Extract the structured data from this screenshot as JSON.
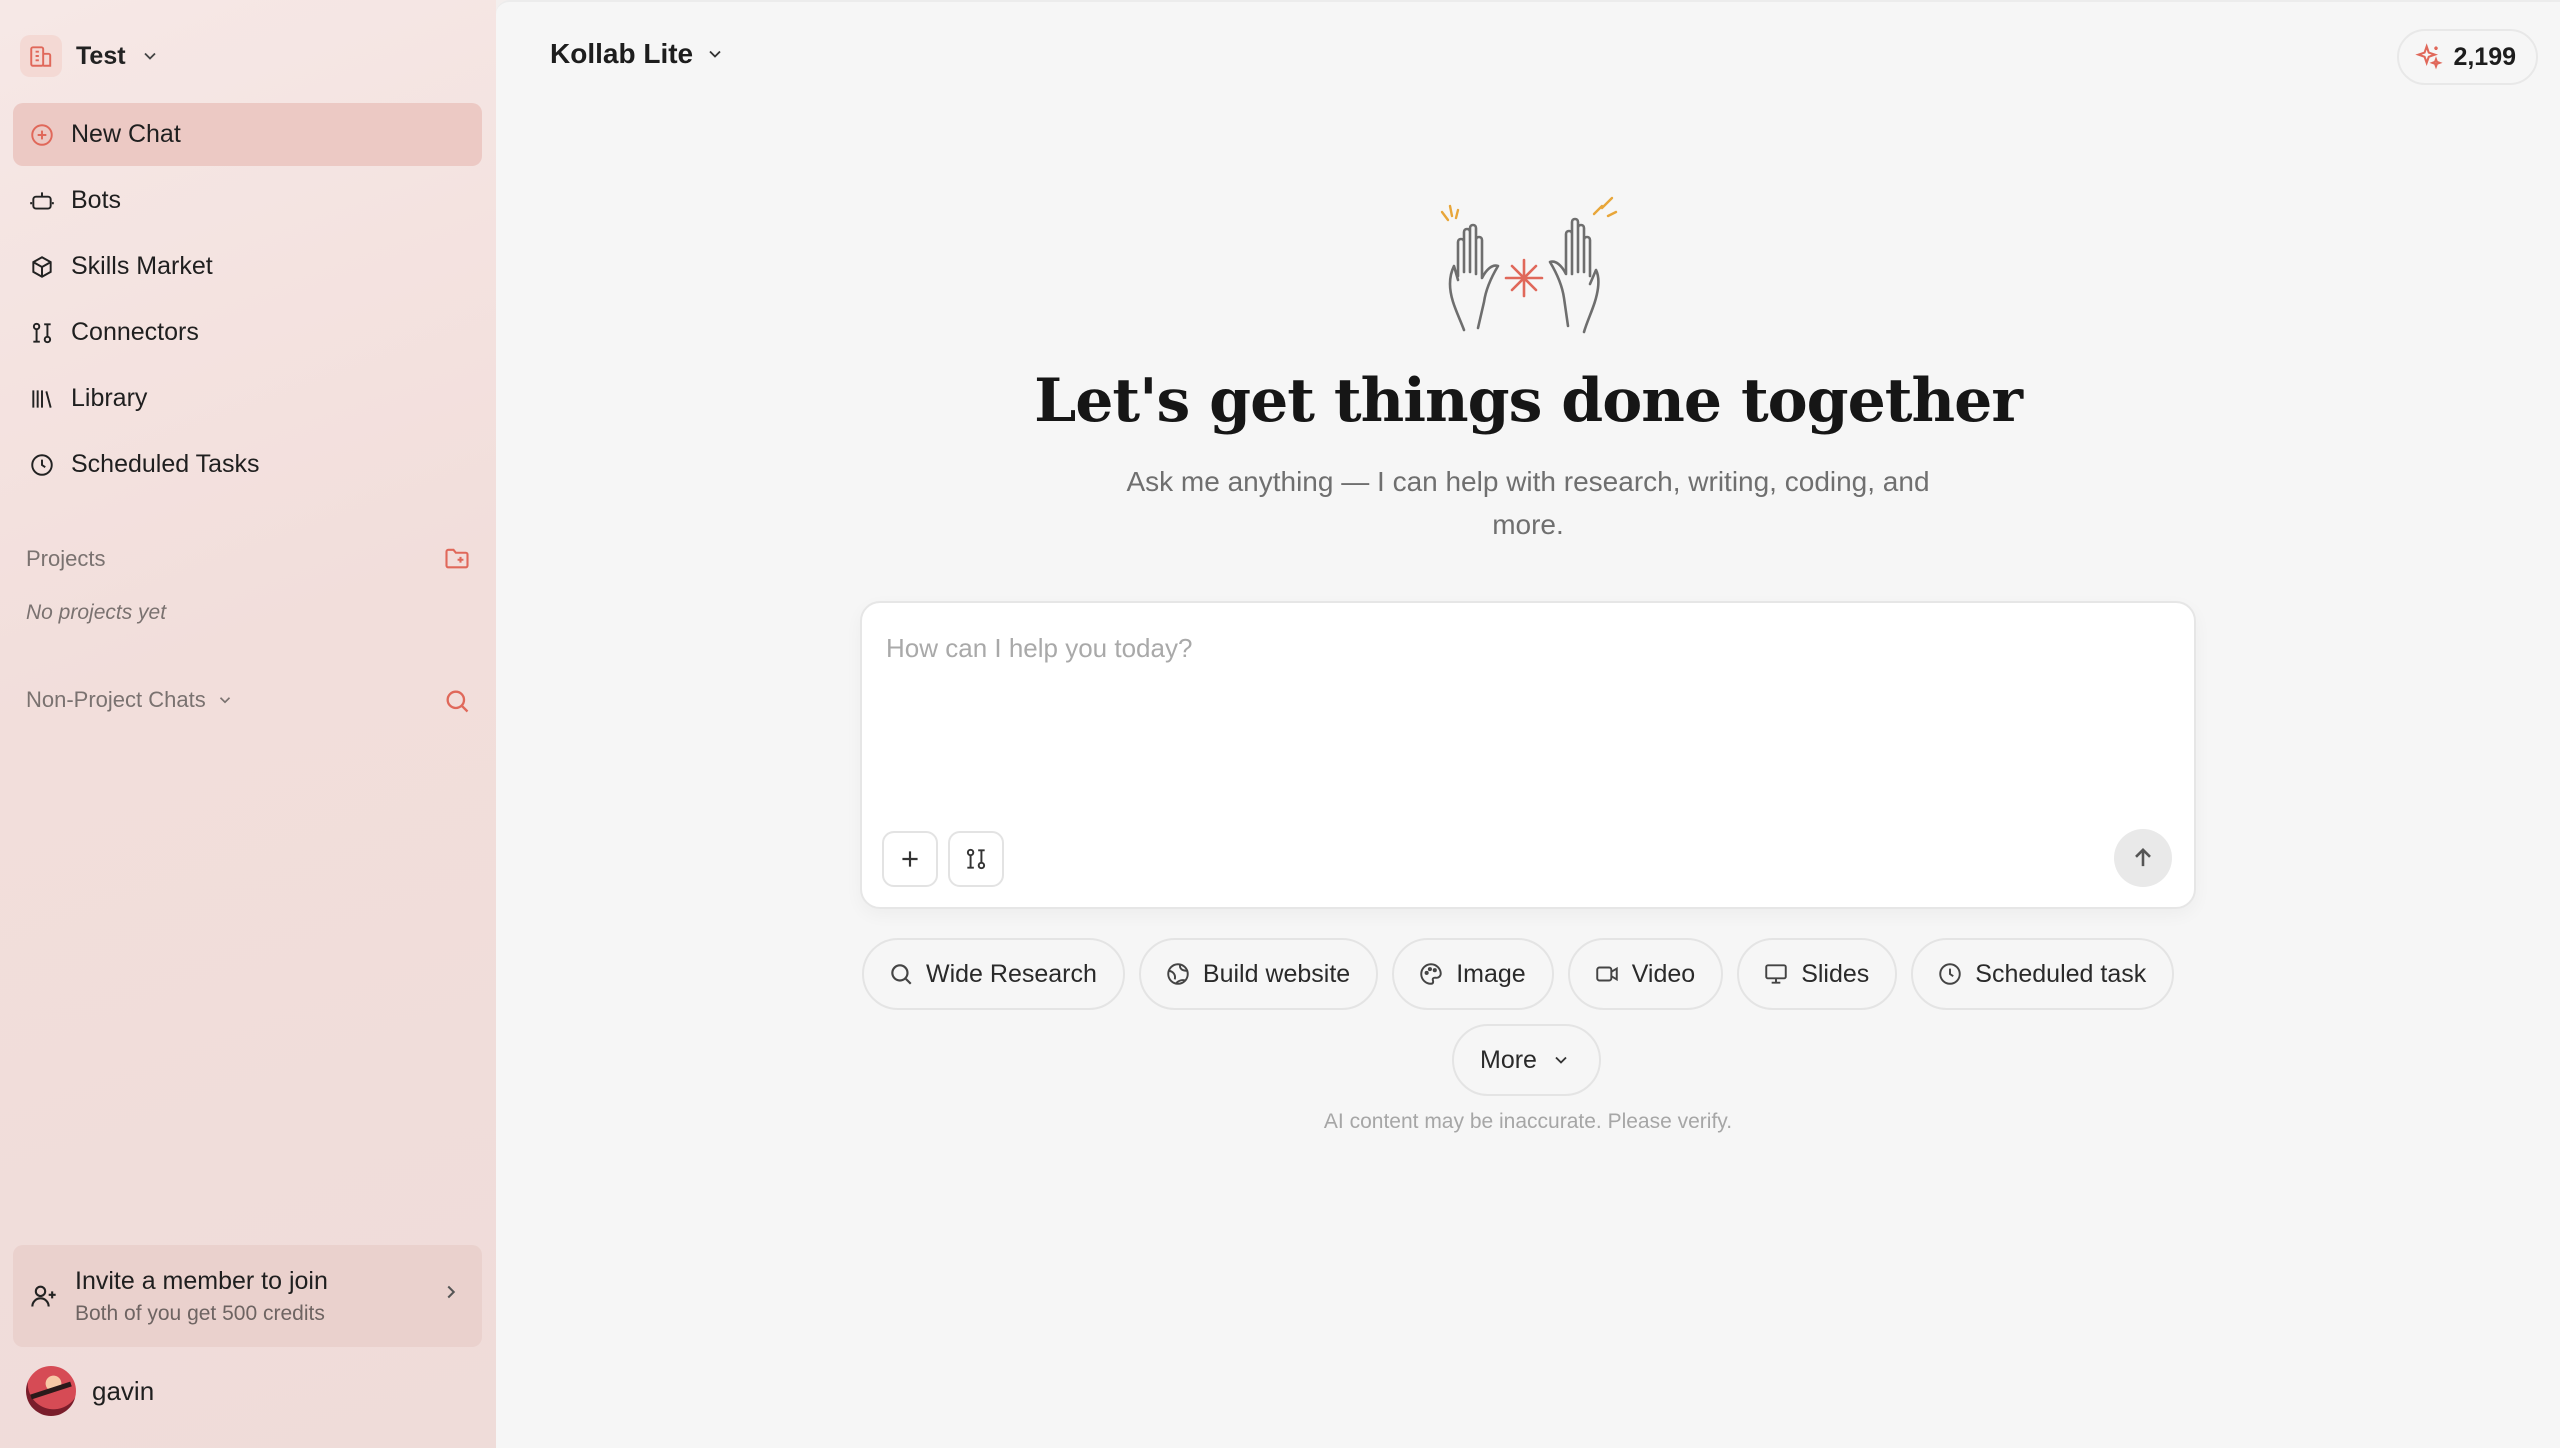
{
  "workspace": {
    "name": "Test"
  },
  "sidebar": {
    "items": [
      {
        "label": "New Chat",
        "icon": "plus-circle-icon",
        "active": true
      },
      {
        "label": "Bots",
        "icon": "bot-icon"
      },
      {
        "label": "Skills Market",
        "icon": "cube-icon"
      },
      {
        "label": "Connectors",
        "icon": "connector-icon"
      },
      {
        "label": "Library",
        "icon": "library-icon"
      },
      {
        "label": "Scheduled Tasks",
        "icon": "clock-icon"
      }
    ],
    "projects": {
      "label": "Projects",
      "empty_text": "No projects yet"
    },
    "chats": {
      "label": "Non-Project Chats"
    },
    "invite": {
      "title": "Invite a member to join",
      "subtitle": "Both of you get 500 credits"
    },
    "user": {
      "name": "gavin"
    }
  },
  "header": {
    "model": "Kollab Lite",
    "credits": "2,199"
  },
  "main": {
    "headline": "Let's get things done together",
    "subline": "Ask me anything — I can help with research, writing, coding, and more.",
    "composer_placeholder": "How can I help you today?",
    "chips": [
      {
        "label": "Wide Research",
        "icon": "search-icon"
      },
      {
        "label": "Build website",
        "icon": "globe-icon"
      },
      {
        "label": "Image",
        "icon": "palette-icon"
      },
      {
        "label": "Video",
        "icon": "video-icon"
      },
      {
        "label": "Slides",
        "icon": "presentation-icon"
      },
      {
        "label": "Scheduled task",
        "icon": "clock-icon"
      }
    ],
    "more_label": "More",
    "disclaimer": "AI content may be inaccurate. Please verify."
  },
  "colors": {
    "accent": "#e0685a",
    "active_bg": "#ecc9c4"
  }
}
